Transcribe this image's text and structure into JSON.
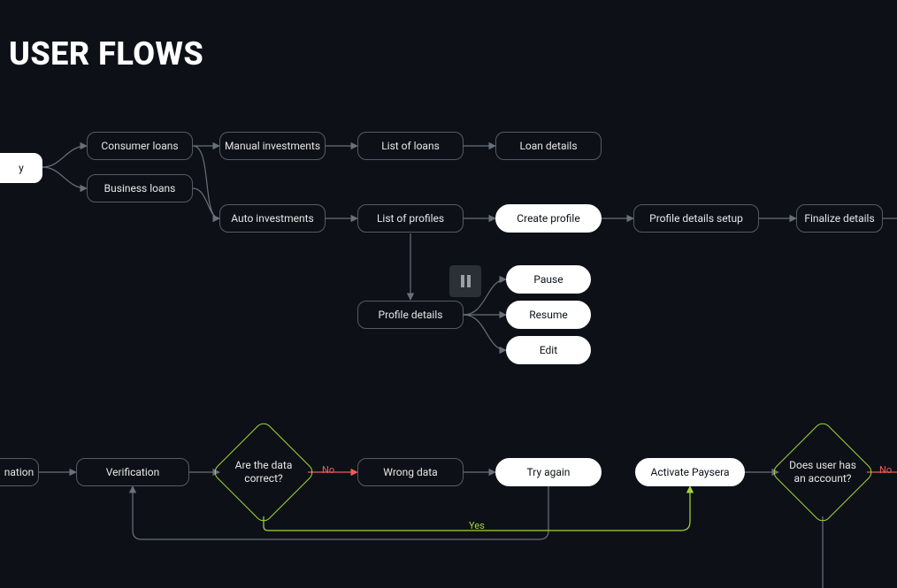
{
  "title": "USER FLOWS",
  "row1": {
    "start_partial": "y",
    "consumer": "Consumer loans",
    "business": "Business loans",
    "manual": "Manual investments",
    "listloans": "List of loans",
    "loandetails": "Loan details"
  },
  "row2": {
    "auto": "Auto investments",
    "listprofiles": "List of profiles",
    "createprofile": "Create profile",
    "profilesetup": "Profile details setup",
    "finalize": "Finalize details"
  },
  "row3": {
    "profiledetails": "Profile details",
    "pause": "Pause",
    "resume": "Resume",
    "edit": "Edit"
  },
  "row4": {
    "nation_partial": "nation",
    "verification": "Verification",
    "diamond1": "Are the data correct?",
    "no": "No",
    "wrongdata": "Wrong data",
    "tryagain": "Try again",
    "yes": "Yes",
    "activate": "Activate Paysera",
    "diamond2": "Does user has an account?",
    "no2": "No"
  }
}
